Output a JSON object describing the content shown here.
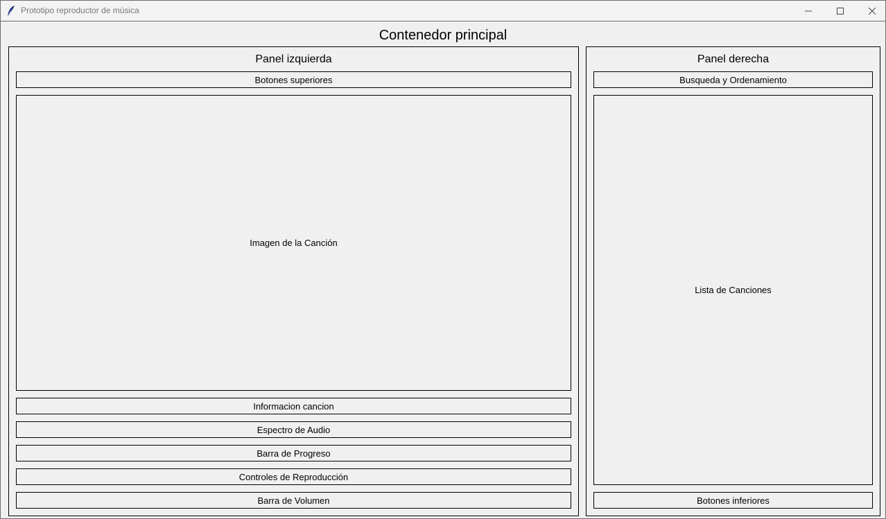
{
  "window": {
    "title": "Prototipo reproductor de música",
    "app_icon": "feather-icon",
    "controls": [
      "minimize-icon",
      "maximize-icon",
      "close-icon"
    ]
  },
  "main": {
    "title": "Contenedor principal"
  },
  "left_panel": {
    "title": "Panel izquierda",
    "top_buttons": "Botones superiores",
    "song_image": "Imagen de la Canción",
    "song_info": "Informacion cancion",
    "audio_spectrum": "Espectro de Audio",
    "progress_bar": "Barra de Progreso",
    "playback_controls": "Controles de Reproducción",
    "volume_bar": "Barra de Volumen"
  },
  "right_panel": {
    "title": "Panel derecha",
    "search_sort": "Busqueda y Ordenamiento",
    "song_list": "Lista de Canciones",
    "bottom_buttons": "Botones inferiores"
  }
}
